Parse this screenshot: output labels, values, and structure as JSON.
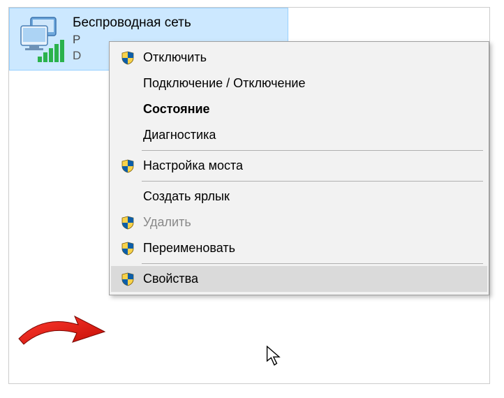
{
  "adapter": {
    "title": "Беспроводная сеть",
    "line2_initial": "P",
    "line3_initial": "D"
  },
  "menu": {
    "disable": "Отключить",
    "connect": "Подключение / Отключение",
    "status": "Состояние",
    "diagnostics": "Диагностика",
    "bridge": "Настройка моста",
    "shortcut": "Создать ярлык",
    "delete": "Удалить",
    "rename": "Переименовать",
    "properties": "Свойства"
  }
}
